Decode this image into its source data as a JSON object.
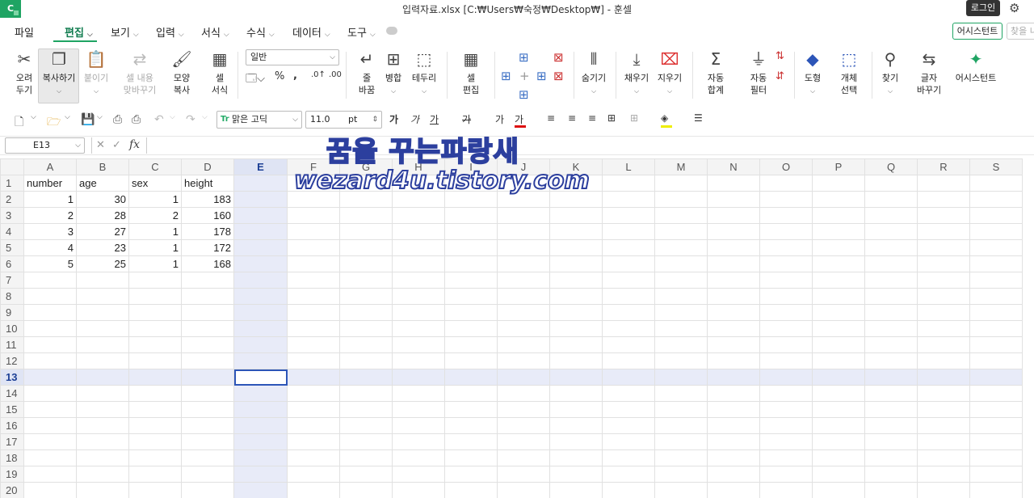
{
  "app": {
    "logo": "C",
    "title": "입력자료.xlsx [C:₩Users₩숙정₩Desktop₩] - 훈셀",
    "login": "로그인",
    "assistant_btn": "어시스턴트",
    "find_placeholder": "찾을 내"
  },
  "menu": [
    {
      "label": "파일"
    },
    {
      "label": "편집",
      "active": true
    },
    {
      "label": "보기"
    },
    {
      "label": "입력"
    },
    {
      "label": "서식"
    },
    {
      "label": "수식"
    },
    {
      "label": "데이터"
    },
    {
      "label": "도구"
    }
  ],
  "ribbon": {
    "cut": [
      "오려",
      "두기"
    ],
    "copy": "복사하기",
    "paste": "붙이기",
    "paste_content": [
      "셀 내용",
      "맞바꾸기"
    ],
    "format_painter": [
      "모양",
      "복사"
    ],
    "cell_format": [
      "셀",
      "서식"
    ],
    "number_format": "일반",
    "wrap": [
      "줄",
      "바꿈"
    ],
    "merge": "병합",
    "border": "테두리",
    "cell_edit": [
      "셀",
      "편집"
    ],
    "hide": "숨기기",
    "fill": "채우기",
    "clear": "지우기",
    "autosum": [
      "자동",
      "합계"
    ],
    "autofilter": [
      "자동",
      "필터"
    ],
    "shape": "도형",
    "object_select": [
      "개체",
      "선택"
    ],
    "find": "찾기",
    "replace": [
      "글자",
      "바꾸기"
    ],
    "assistant": "어시스턴트"
  },
  "toolbar2": {
    "font": "맑은 고딕",
    "size": "11.0",
    "unit": "pt",
    "bold": "가",
    "italic": "가",
    "underline": "가",
    "strike": "가",
    "fontcolor": "가"
  },
  "formula": {
    "namebox": "E13",
    "fx": "fx",
    "value": ""
  },
  "sheet": {
    "columns": [
      "A",
      "B",
      "C",
      "D",
      "E",
      "F",
      "G",
      "H",
      "I",
      "J",
      "K",
      "L",
      "M",
      "N",
      "O",
      "P",
      "Q",
      "R",
      "S"
    ],
    "rows": [
      [
        "number",
        "age",
        "sex",
        "height"
      ],
      [
        "1",
        "30",
        "1",
        "183"
      ],
      [
        "2",
        "28",
        "2",
        "160"
      ],
      [
        "3",
        "27",
        "1",
        "178"
      ],
      [
        "4",
        "23",
        "1",
        "172"
      ],
      [
        "5",
        "25",
        "1",
        "168"
      ]
    ],
    "row_count": 20,
    "active_cell": "E13"
  },
  "watermark": {
    "line1": "꿈을 꾸는파랑새",
    "line2": "wezard4u.tistory.com"
  }
}
